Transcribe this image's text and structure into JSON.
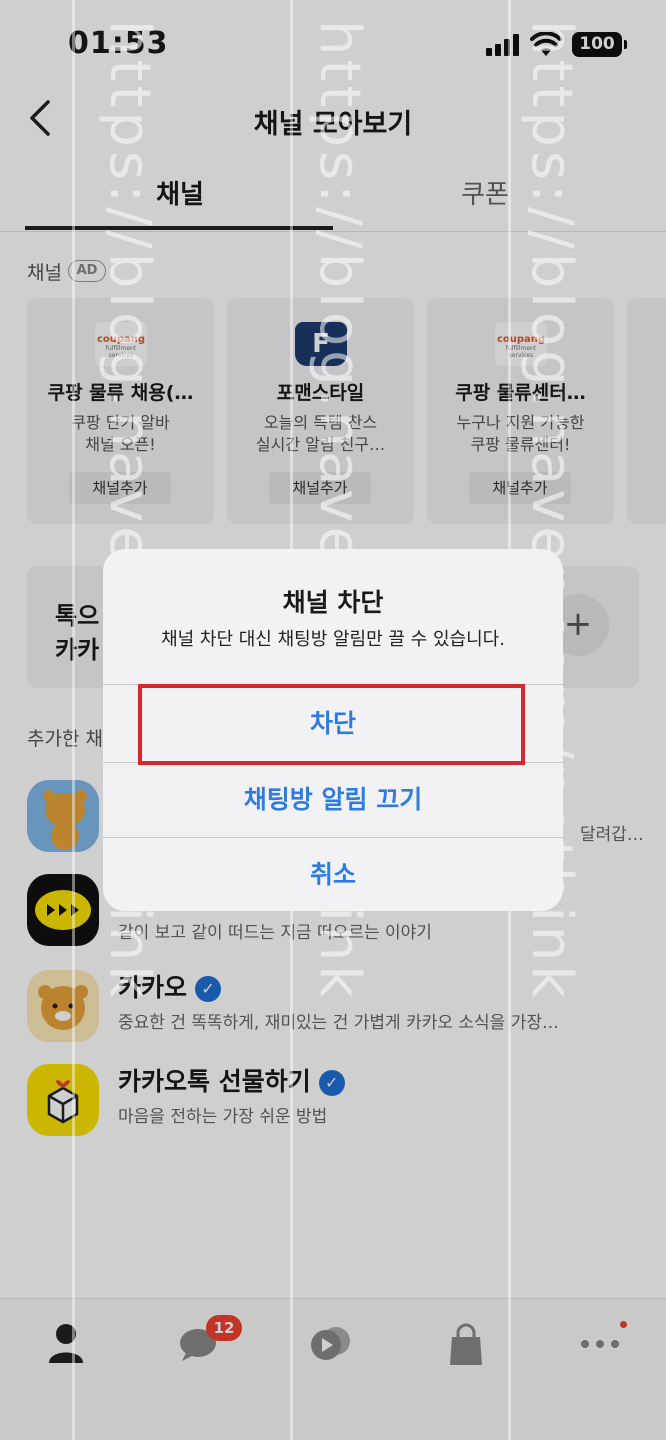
{
  "status_bar": {
    "time": "01:53",
    "battery": "100"
  },
  "header": {
    "title": "채널 모아보기"
  },
  "tabs": [
    {
      "label": "채널"
    },
    {
      "label": "쿠폰"
    }
  ],
  "recommended": {
    "label": "채널",
    "ad_badge": "AD",
    "cards": [
      {
        "logo": "coupang",
        "logo_sub": "fulfillment services",
        "name": "쿠팡 물류 채용(…",
        "desc_line1": "쿠팡 단기 알바",
        "desc_line2": "채널 오픈!",
        "button": "채널추가"
      },
      {
        "logo": "F",
        "name": "포맨스타일",
        "desc_line1": "오늘의 득템 찬스",
        "desc_line2": "실시간 알림 친구…",
        "button": "채널추가"
      },
      {
        "logo": "coupang",
        "logo_sub": "fulfillment services",
        "name": "쿠팡 물류센터…",
        "desc_line1": "누구나 지원 가능한",
        "desc_line2": "쿠팡 물류센터!",
        "button": "채널추가"
      }
    ]
  },
  "promo": {
    "line1": "톡으",
    "line2": "카카",
    "plus": "+"
  },
  "added_section": {
    "label": "추가한 채"
  },
  "channels": [
    {
      "name": "",
      "desc": "달려갑…",
      "verified": false
    },
    {
      "name": "",
      "desc": "같이 보고 같이 떠드는  지금 떠오르는 이야기",
      "verified": false
    },
    {
      "name": "카카오",
      "desc": "중요한 건 똑똑하게, 재미있는 건 가볍게  카카오 소식을 가장…",
      "verified": true
    },
    {
      "name": "카카오톡 선물하기",
      "desc": "마음을 전하는 가장 쉬운 방법",
      "verified": true
    }
  ],
  "bottom_nav": {
    "chat_badge": "12"
  },
  "dialog": {
    "title": "채널 차단",
    "message": "채널 차단 대신 채팅방 알림만 끌 수 있습니다.",
    "actions": {
      "block": "차단",
      "mute": "채팅방 알림 끄기",
      "cancel": "취소"
    }
  },
  "watermark": {
    "text": "https://blog.naver.com/nothink"
  },
  "colors": {
    "accent_blue": "#2d7de0",
    "highlight_red": "#d9262f",
    "badge_red": "#f0412f",
    "kakao_yellow": "#fae100"
  }
}
